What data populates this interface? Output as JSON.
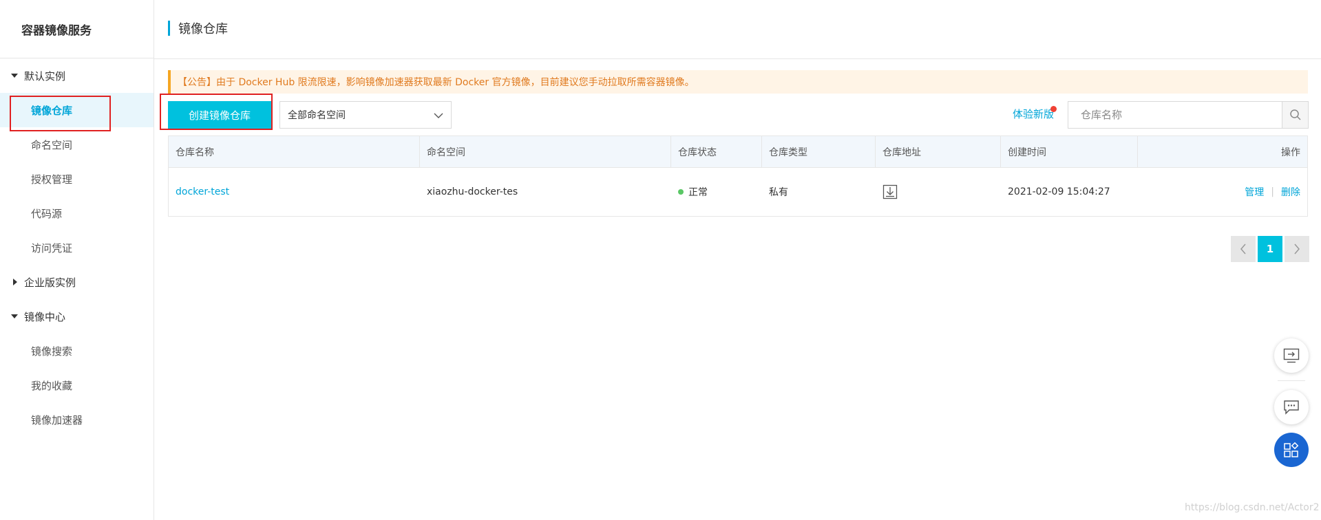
{
  "sidebar": {
    "title": "容器镜像服务",
    "groups": [
      {
        "label": "默认实例",
        "expanded": true,
        "items": [
          "镜像仓库",
          "命名空间",
          "授权管理",
          "代码源",
          "访问凭证"
        ]
      },
      {
        "label": "企业版实例",
        "expanded": false
      },
      {
        "label": "镜像中心",
        "expanded": true,
        "items": [
          "镜像搜索",
          "我的收藏",
          "镜像加速器"
        ]
      }
    ],
    "active_item": "镜像仓库"
  },
  "header": {
    "title": "镜像仓库"
  },
  "notice": {
    "text": "【公告】由于 Docker Hub 限流限速，影响镜像加速器获取最新 Docker 官方镜像，目前建议您手动拉取所需容器镜像。"
  },
  "toolbar": {
    "create_button": "创建镜像仓库",
    "namespace_select": "全部命名空间",
    "try_new": "体验新版",
    "search_placeholder": "仓库名称"
  },
  "table": {
    "headers": [
      "仓库名称",
      "命名空间",
      "仓库状态",
      "仓库类型",
      "仓库地址",
      "创建时间",
      "操作"
    ],
    "rows": [
      {
        "name": "docker-test",
        "namespace": "xiaozhu-docker-tes",
        "status": "正常",
        "type": "私有",
        "created": "2021-02-09 15:04:27",
        "action_manage": "管理",
        "action_sep": "|",
        "action_delete": "删除"
      }
    ]
  },
  "pagination": {
    "current": "1"
  },
  "watermark": "https://blog.csdn.net/Actor2",
  "colors": {
    "accent": "#00c1de",
    "link": "#00a5d8",
    "notice_text": "#e07a1f",
    "highlight": "#e02020",
    "status_ok": "#5ac765"
  }
}
